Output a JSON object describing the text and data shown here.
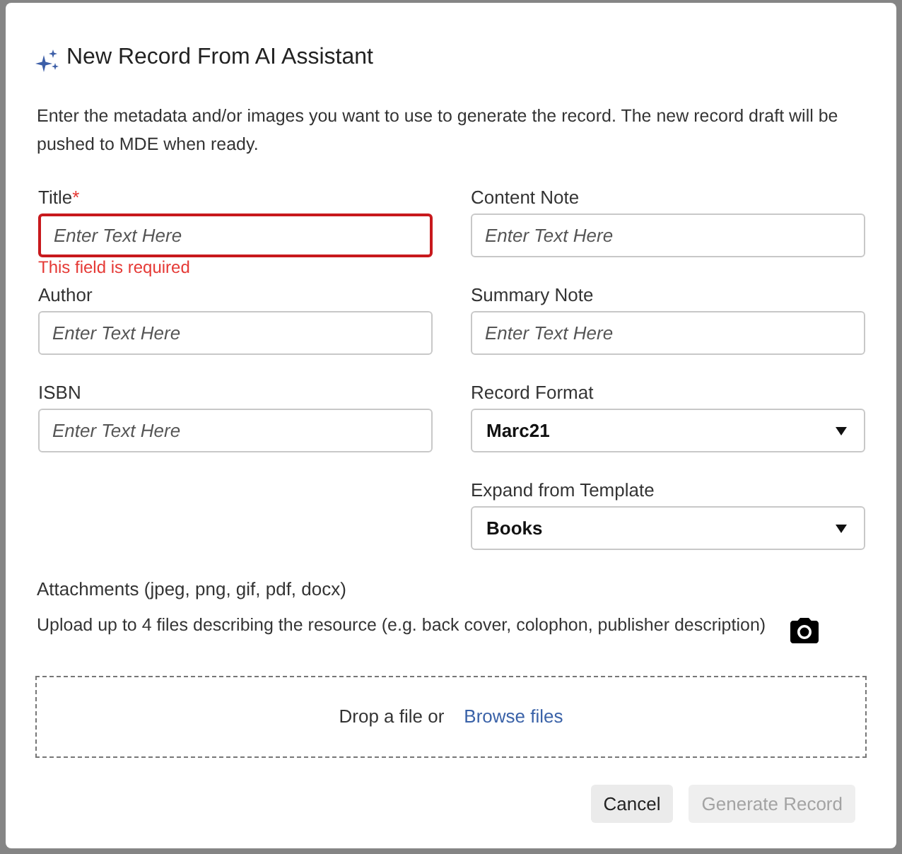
{
  "dialog": {
    "title": "New Record From AI Assistant",
    "description": "Enter the metadata and/or images you want to use to generate the record. The new record draft will be pushed to MDE when ready."
  },
  "fields": {
    "left": [
      {
        "kind": "text",
        "label": "Title",
        "required_mark": "*",
        "placeholder": "Enter Text Here",
        "error": "This field is required"
      },
      {
        "kind": "text",
        "label": "Author",
        "placeholder": "Enter Text Here"
      },
      {
        "kind": "text",
        "label": "ISBN",
        "placeholder": "Enter Text Here"
      }
    ],
    "right": [
      {
        "kind": "text",
        "label": "Content Note",
        "placeholder": "Enter Text Here"
      },
      {
        "kind": "text",
        "label": "Summary Note",
        "placeholder": "Enter Text Here"
      },
      {
        "kind": "select",
        "label": "Record Format",
        "value": "Marc21"
      },
      {
        "kind": "select",
        "label": "Expand from Template",
        "value": "Books"
      }
    ]
  },
  "attachments": {
    "label": "Attachments (jpeg, png, gif, pdf, docx)",
    "hint": "Upload up to 4 files describing the resource (e.g. back cover, colophon, publisher description)",
    "drop_text": "Drop a file or",
    "browse_link": "Browse files"
  },
  "buttons": [
    {
      "label": "Cancel",
      "disabled": false
    },
    {
      "label": "Generate Record",
      "disabled": true
    }
  ]
}
